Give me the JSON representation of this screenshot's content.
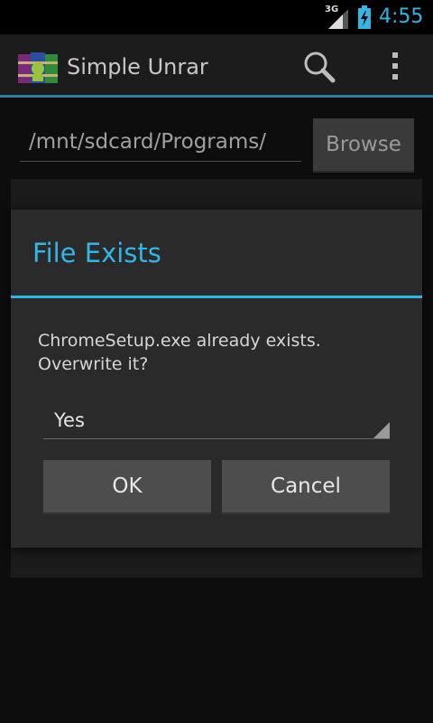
{
  "status_bar": {
    "network": "3G",
    "time": "4:55"
  },
  "action_bar": {
    "title": "Simple Unrar",
    "icons": {
      "app": "winrar-app-icon",
      "search": "search-icon",
      "overflow": "overflow-menu-icon"
    }
  },
  "main": {
    "path_value": "/mnt/sdcard/Programs/",
    "browse_label": "Browse"
  },
  "dialog": {
    "title": "File Exists",
    "message": "ChromeSetup.exe already exists. Overwrite it?",
    "spinner_value": "Yes",
    "ok_label": "OK",
    "cancel_label": "Cancel"
  },
  "colors": {
    "accent": "#33b5e5",
    "action_bar_divider": "#2d7ea1",
    "dialog_bg": "#2a2a2a",
    "button_bg": "#4d4d4d"
  }
}
